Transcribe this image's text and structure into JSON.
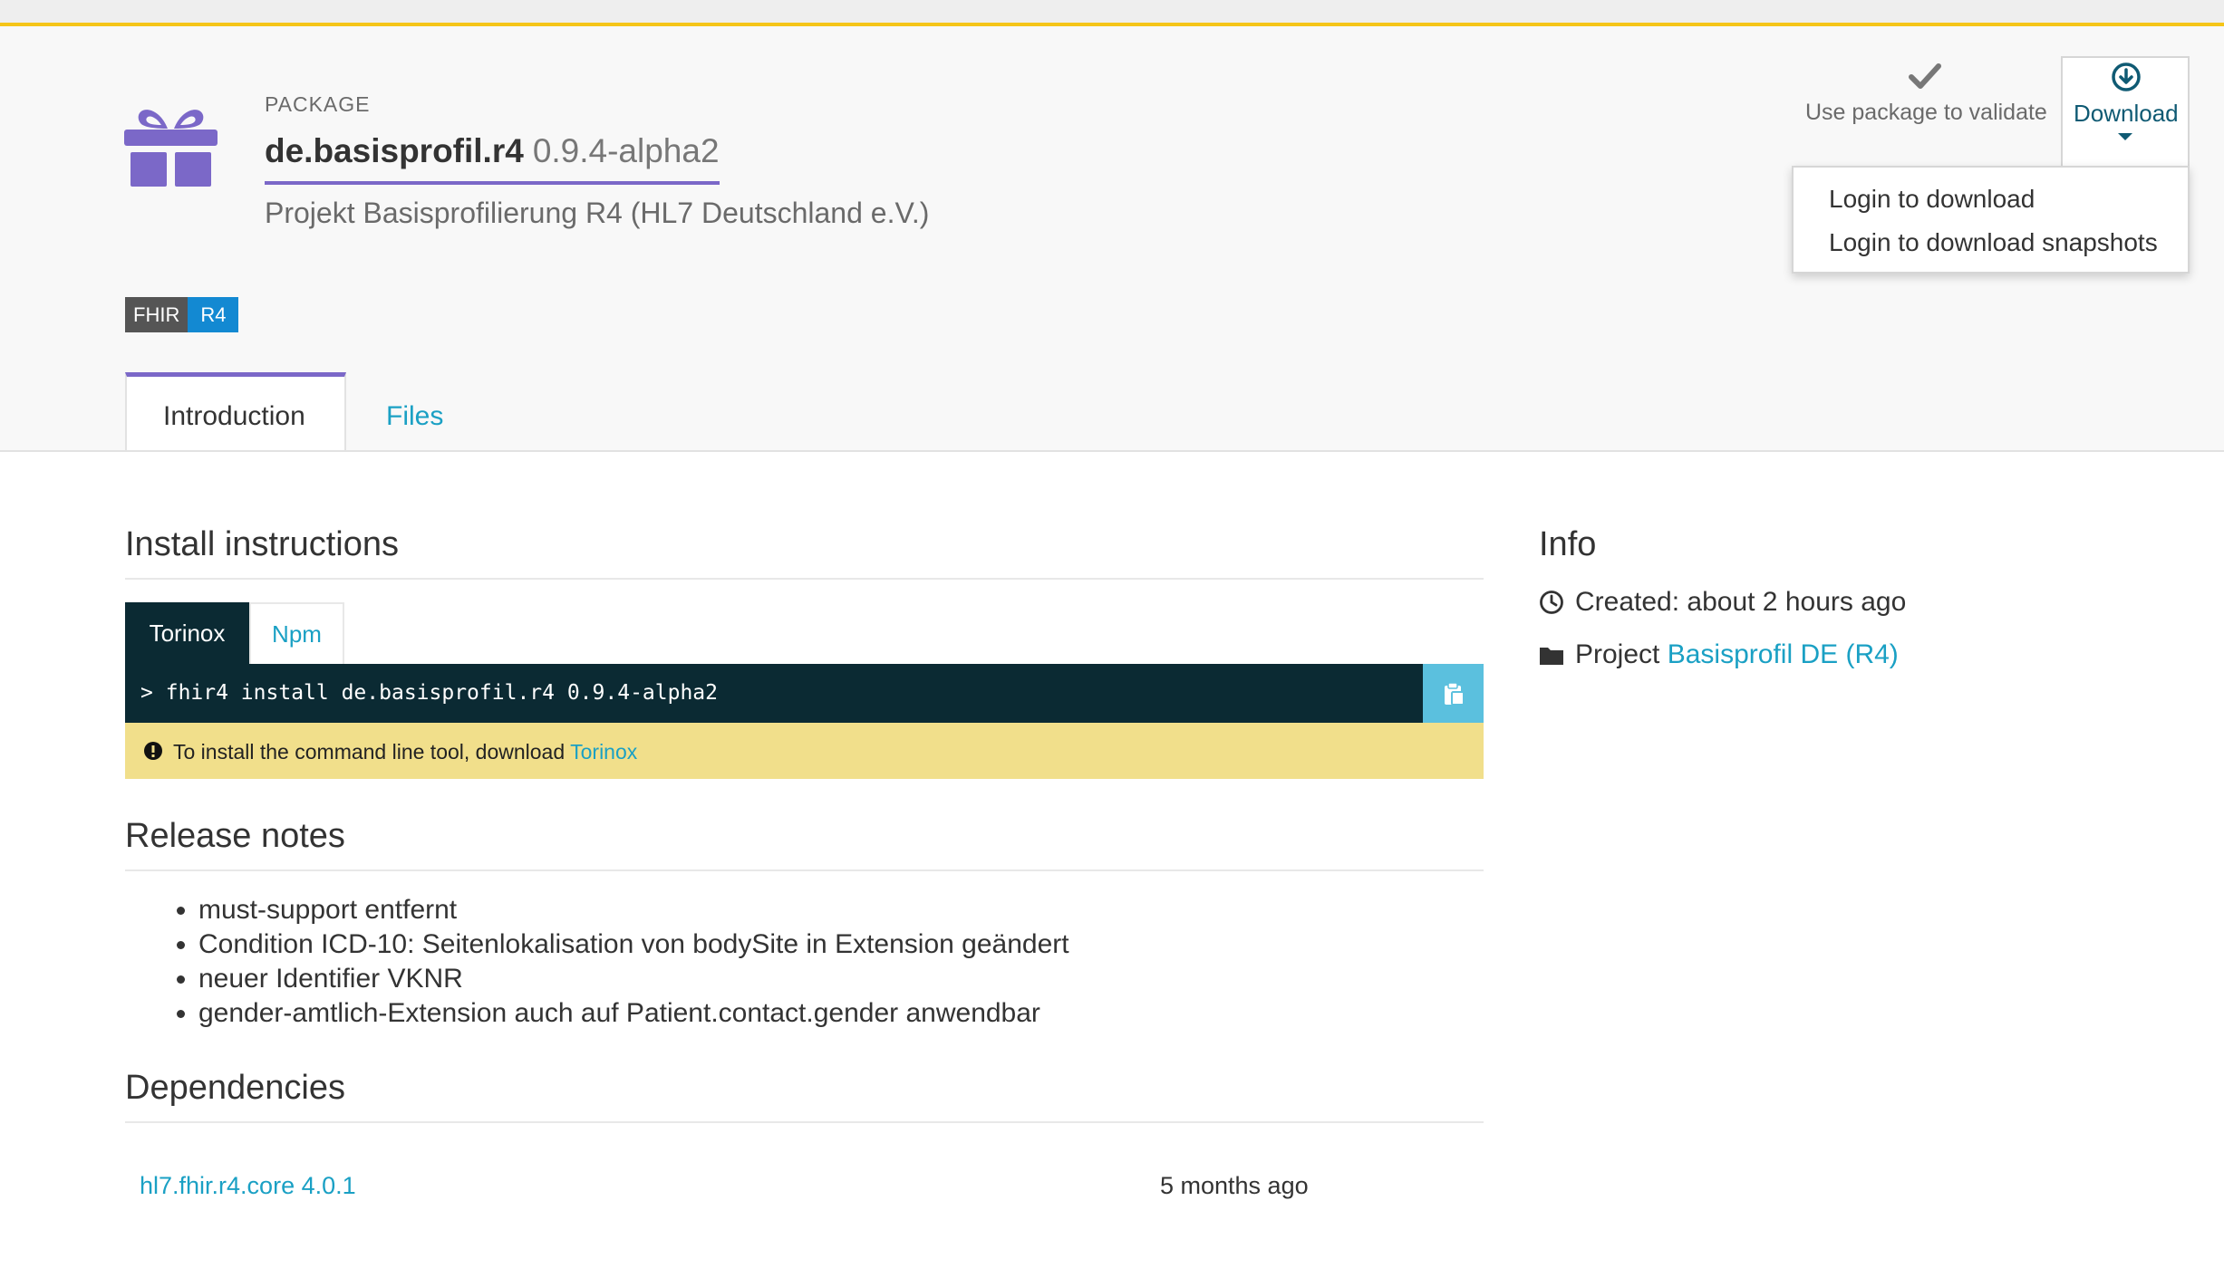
{
  "package": {
    "label": "PACKAGE",
    "name": "de.basisprofil.r4",
    "version": "0.9.4-alpha2",
    "description": "Projekt Basisprofilierung R4 (HL7 Deutschland e.V.)",
    "badge_left": "FHIR",
    "badge_right": "R4"
  },
  "header_actions": {
    "validate_label": "Use package to validate",
    "download_label": "Download",
    "dropdown_items": [
      "Login to download",
      "Login to download snapshots"
    ]
  },
  "tabs": {
    "introduction": "Introduction",
    "files": "Files"
  },
  "install": {
    "heading": "Install instructions",
    "tabs": [
      "Torinox",
      "Npm"
    ],
    "prompt": ">",
    "command": "fhir4 install de.basisprofil.r4 0.9.4-alpha2",
    "notice_text": "To install the command line tool, download ",
    "notice_link": "Torinox"
  },
  "release_notes": {
    "heading": "Release notes",
    "items": [
      "must-support entfernt",
      "Condition ICD-10: Seitenlokalisation von bodySite in Extension geändert",
      "neuer Identifier VKNR",
      "gender-amtlich-Extension auch auf Patient.contact.gender anwendbar"
    ]
  },
  "dependencies": {
    "heading": "Dependencies",
    "rows": [
      {
        "name": "hl7.fhir.r4.core 4.0.1",
        "time": "5 months ago"
      }
    ]
  },
  "info": {
    "heading": "Info",
    "created": "Created: about 2 hours ago",
    "project_label": "Project ",
    "project_link": "Basisprofil DE (R4)"
  },
  "icons": {
    "package": "gift-icon",
    "validate": "checkmark-icon",
    "download": "download-circle-icon",
    "copy": "clipboard-icon",
    "notice": "exclamation-circle-icon",
    "created": "clock-icon",
    "project": "folder-icon"
  },
  "colors": {
    "accent": "#7b68c8",
    "link": "#1aa0c4",
    "terminal": "#0b2a33",
    "notice": "#f1df8b",
    "badge_dark": "#555555",
    "badge_blue": "#1389d2",
    "top_border": "#f5c518"
  }
}
